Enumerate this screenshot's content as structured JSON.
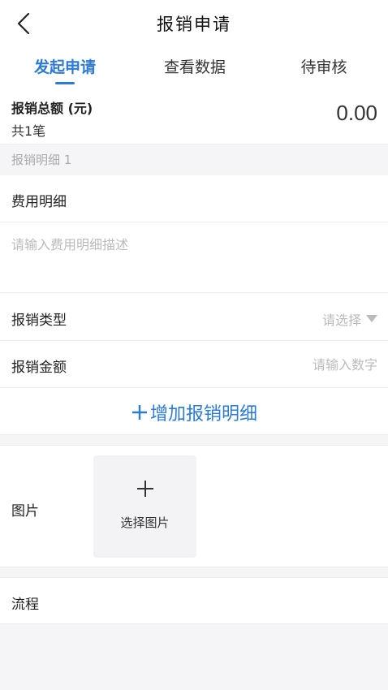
{
  "header": {
    "title": "报销申请",
    "back_icon": "chevron-left-icon"
  },
  "tabs": [
    {
      "label": "发起申请",
      "active": true
    },
    {
      "label": "查看数据",
      "active": false
    },
    {
      "label": "待审核",
      "active": false
    }
  ],
  "total": {
    "label": "报销总额 (元)",
    "count": "共1笔",
    "amount": "0.00"
  },
  "detail": {
    "section_title": "报销明细 1",
    "fee_detail_label": "费用明细",
    "description_placeholder": "请输入费用明细描述",
    "type_label": "报销类型",
    "type_placeholder": "请选择",
    "amount_label": "报销金额",
    "amount_placeholder": "请输入数字",
    "add_label": "增加报销明细"
  },
  "images": {
    "label": "图片",
    "picker_label": "选择图片"
  },
  "flow": {
    "label": "流程"
  },
  "colors": {
    "accent": "#2d7ad6",
    "background": "#f5f5f7",
    "placeholder": "#bbbbbb"
  }
}
